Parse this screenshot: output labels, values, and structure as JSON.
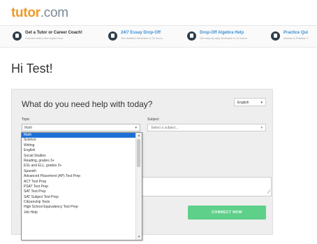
{
  "header": {
    "logo_text": "tutor",
    "logo_suffix": ".com"
  },
  "promo": [
    {
      "title": "Get a Tutor or Career Coach!",
      "subtitle": "Connect with a live expert now",
      "icon": "tutor-icon"
    },
    {
      "title": "24/7 Essay Drop-Off",
      "subtitle": "Get detailed feedback in 24 hours",
      "icon": "essay-icon"
    },
    {
      "title": "Drop-Off Algebra Help",
      "subtitle": "Get step-by-step feedback in 24 hours",
      "icon": "algebra-icon"
    },
    {
      "title": "Practice Qui",
      "subtitle": "Assess & Practice Y",
      "icon": "practice-icon"
    }
  ],
  "greeting": "Hi Test!",
  "form": {
    "title": "What do you need help with today?",
    "language": "English",
    "topic_label": "Topic",
    "topic_value": "Math",
    "subject_label": "Subject",
    "subject_placeholder": "Select a subject...",
    "connect_label": "CONNECT NOW"
  },
  "topics": [
    "Math",
    "Science",
    "Writing",
    "English",
    "Social Studies",
    "Reading, grades 3+",
    "ESL and ELL, grades 3+",
    "Spanish",
    "Advanced Placement (AP) Test Prep",
    "ACT Test Prep",
    "PSAT Test Prep",
    "SAT Test Prep",
    "SAT Subject Test Prep",
    "Citizenship Tests",
    "High School Equivalency Test Prep",
    "Job Help"
  ],
  "selected_topic_index": 0,
  "colors": {
    "brand_orange": "#f09a2a",
    "connect_green": "#5fd08a",
    "selection_blue": "#1e70d6"
  }
}
